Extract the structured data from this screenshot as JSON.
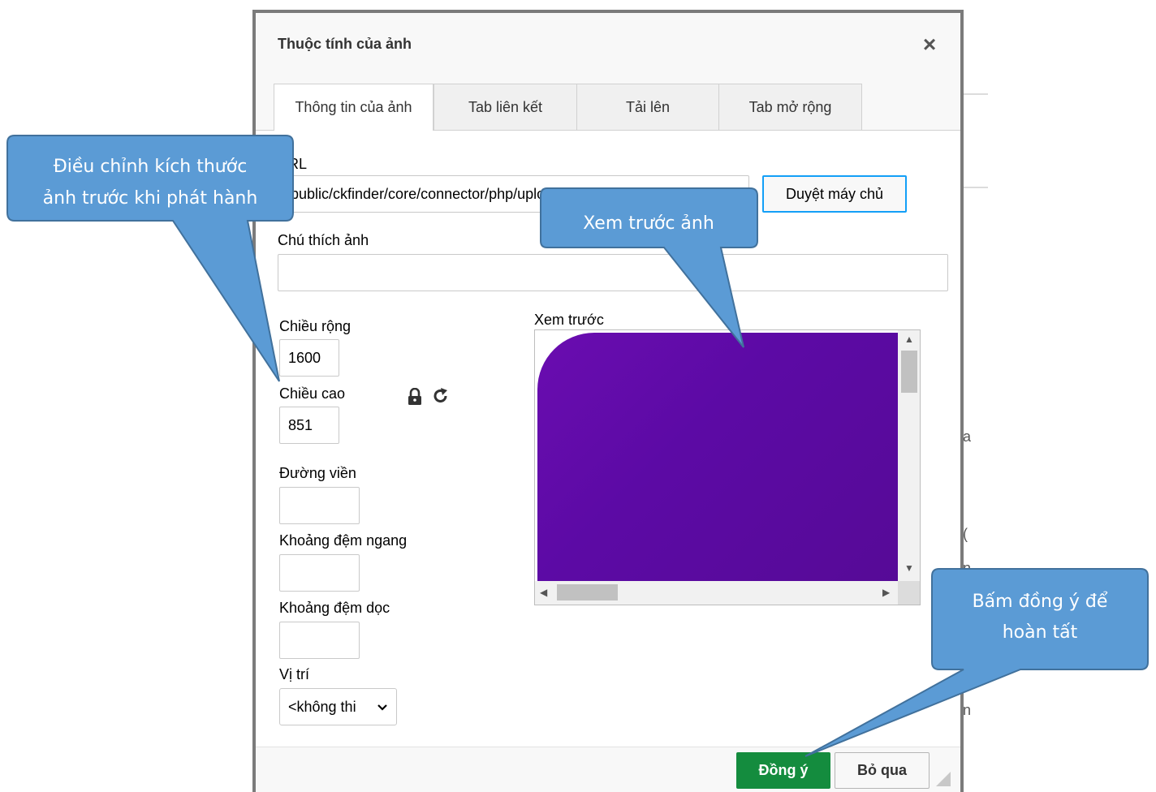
{
  "dialog": {
    "title": "Thuộc tính của ảnh",
    "close_icon": "close-icon"
  },
  "tabs": [
    {
      "label": "Thông tin của ảnh",
      "active": true
    },
    {
      "label": "Tab liên kết",
      "active": false
    },
    {
      "label": "Tải lên",
      "active": false
    },
    {
      "label": "Tab mở rộng",
      "active": false
    }
  ],
  "form": {
    "url_label": "URL",
    "url_value": "public/ckfinder/core/connector/php/uploads/images/banner-bloc",
    "browse_button": "Duyệt máy chủ",
    "caption_label": "Chú thích ảnh",
    "caption_value": "",
    "width_label": "Chiều rộng",
    "width_value": "1600",
    "height_label": "Chiều cao",
    "height_value": "851",
    "border_label": "Đường viền",
    "border_value": "",
    "hspace_label": "Khoảng đệm ngang",
    "hspace_value": "",
    "vspace_label": "Khoảng đệm dọc",
    "vspace_value": "",
    "align_label": "Vị trí",
    "align_selected": "<không thi",
    "preview_label": "Xem trước",
    "preview_color": "#5c0aa5",
    "lock_icon": "lock-icon",
    "reset_icon": "reset-size-icon"
  },
  "footer": {
    "ok_button": "Đồng ý",
    "cancel_button": "Bỏ qua",
    "ok_color": "#148c3e"
  },
  "callouts": {
    "resize_line1": "Điều chỉnh kích thước",
    "resize_line2": "ảnh trước khi phát hành",
    "preview": "Xem trước ảnh",
    "confirm_line1": "Bấm đồng ý để",
    "confirm_line2": "hoàn tất",
    "fill_color": "#5b9bd5",
    "stroke_color": "#41719c"
  },
  "background": {
    "ghost_chars": [
      "a",
      "(",
      "n",
      "n"
    ]
  }
}
